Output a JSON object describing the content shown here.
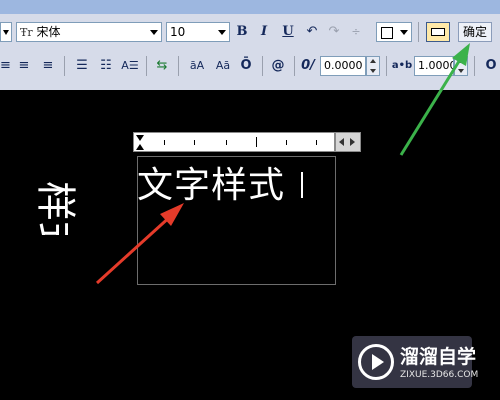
{
  "toolbar": {
    "font_name": "宋体",
    "font_size": "10",
    "bold": "B",
    "italic": "I",
    "underline": "U",
    "color_value": "",
    "ok_label": "确定",
    "stack_label_a": "āA",
    "stack_label_b": "Aā",
    "spin_a_value": "0.0000",
    "spin_b_label": "a•b",
    "spin_b_value": "1.0000",
    "at_label": "@",
    "oblique_label": "0/"
  },
  "editor": {
    "text": "文字样式"
  },
  "rotated_text": "样式",
  "watermark": {
    "title": "溜溜自学",
    "subtitle": "ZIXUE.3D66.COM"
  },
  "colors": {
    "canvas": "#000000",
    "toolbar": "#d6dbe9",
    "arrow_red": "#e53b2a",
    "arrow_green": "#3bb24a"
  }
}
